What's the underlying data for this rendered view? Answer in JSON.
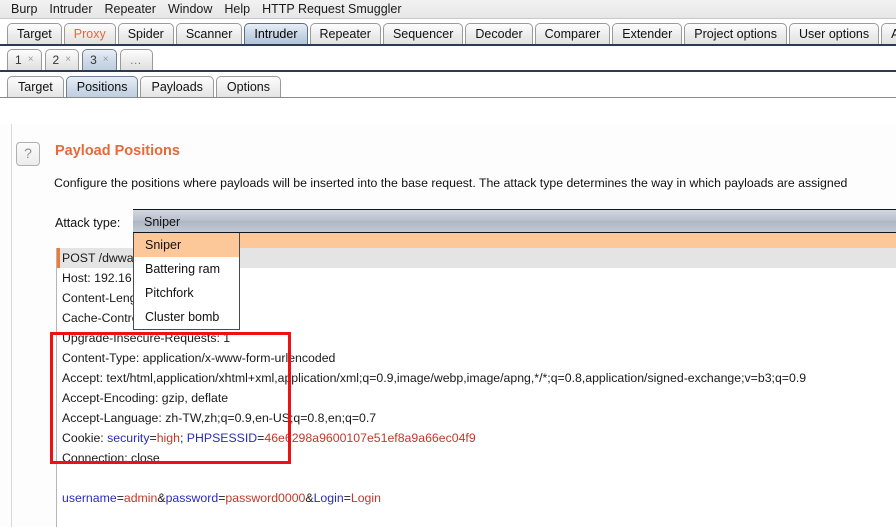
{
  "menubar": {
    "items": [
      {
        "label": "Burp"
      },
      {
        "label": "Intruder"
      },
      {
        "label": "Repeater"
      },
      {
        "label": "Window"
      },
      {
        "label": "Help"
      },
      {
        "label": "HTTP Request Smuggler"
      }
    ]
  },
  "main_tabs": [
    {
      "label": "Target",
      "state": "normal"
    },
    {
      "label": "Proxy",
      "state": "accent"
    },
    {
      "label": "Spider",
      "state": "normal"
    },
    {
      "label": "Scanner",
      "state": "normal"
    },
    {
      "label": "Intruder",
      "state": "active"
    },
    {
      "label": "Repeater",
      "state": "normal"
    },
    {
      "label": "Sequencer",
      "state": "normal"
    },
    {
      "label": "Decoder",
      "state": "normal"
    },
    {
      "label": "Comparer",
      "state": "normal"
    },
    {
      "label": "Extender",
      "state": "normal"
    },
    {
      "label": "Project options",
      "state": "normal"
    },
    {
      "label": "User options",
      "state": "normal"
    },
    {
      "label": "Alerts",
      "state": "normal"
    }
  ],
  "attack_tabs": [
    {
      "label": "1",
      "close": "×",
      "state": "normal"
    },
    {
      "label": "2",
      "close": "×",
      "state": "normal"
    },
    {
      "label": "3",
      "close": "×",
      "state": "active"
    },
    {
      "label": "…",
      "close": "",
      "state": "dots"
    }
  ],
  "sub_tabs": [
    {
      "label": "Target",
      "state": "normal"
    },
    {
      "label": "Positions",
      "state": "active"
    },
    {
      "label": "Payloads",
      "state": "normal"
    },
    {
      "label": "Options",
      "state": "normal"
    }
  ],
  "panel": {
    "help_icon": "?",
    "title": "Payload Positions",
    "description": "Configure the positions where payloads will be inserted into the base request. The attack type determines the way in which payloads are assigned"
  },
  "attack_type": {
    "label": "Attack type:",
    "selected": "Sniper",
    "options": [
      {
        "label": "Sniper",
        "selected": true
      },
      {
        "label": "Battering ram",
        "selected": false
      },
      {
        "label": "Pitchfork",
        "selected": false
      },
      {
        "label": "Cluster bomb",
        "selected": false
      }
    ]
  },
  "request": {
    "lines": [
      {
        "text": "POST /dwwa/",
        "style": "first"
      },
      {
        "text": "Host: 192.16",
        "style": "plain"
      },
      {
        "text": "Content-Leng",
        "style": "plain"
      },
      {
        "text": "Cache-Contro",
        "style": "plain"
      },
      {
        "text": "Upgrade-Insecure-Requests: 1",
        "style": "plain"
      },
      {
        "text": "Content-Type: application/x-www-form-urlencoded",
        "style": "plain"
      },
      {
        "text": "Accept: text/html,application/xhtml+xml,application/xml;q=0.9,image/webp,image/apng,*/*;q=0.8,application/signed-exchange;v=b3;q=0.9",
        "style": "plain"
      },
      {
        "text": "Accept-Encoding: gzip, deflate",
        "style": "plain"
      },
      {
        "text": "Accept-Language: zh-TW,zh;q=0.9,en-US;q=0.8,en;q=0.7",
        "style": "plain"
      },
      {
        "style": "cookie",
        "prefix": "Cookie: ",
        "parts": [
          {
            "text": "security",
            "kind": "key"
          },
          {
            "text": "=",
            "kind": "plain"
          },
          {
            "text": "high",
            "kind": "val"
          },
          {
            "text": "; ",
            "kind": "plain"
          },
          {
            "text": "PHPSESSID",
            "kind": "key"
          },
          {
            "text": "=",
            "kind": "plain"
          },
          {
            "text": "46e6298a9600107e51ef8a9a66ec04f9",
            "kind": "val"
          }
        ]
      },
      {
        "text": "Connection: close",
        "style": "plain"
      },
      {
        "text": "",
        "style": "blank"
      },
      {
        "style": "body",
        "prefix": "",
        "parts": [
          {
            "text": "username",
            "kind": "key"
          },
          {
            "text": "=",
            "kind": "plain"
          },
          {
            "text": "admin",
            "kind": "val"
          },
          {
            "text": "&",
            "kind": "plain"
          },
          {
            "text": "password",
            "kind": "key"
          },
          {
            "text": "=",
            "kind": "plain"
          },
          {
            "text": "password0000",
            "kind": "val"
          },
          {
            "text": "&",
            "kind": "plain"
          },
          {
            "text": "Login",
            "kind": "key"
          },
          {
            "text": "=",
            "kind": "plain"
          },
          {
            "text": "Login",
            "kind": "val"
          }
        ]
      }
    ]
  },
  "colors": {
    "accent_orange": "#e8683a",
    "highlight_peach": "#fcc89a",
    "annotation_red": "#ee1111",
    "param_key_blue": "#2b2bbf",
    "param_value_red": "#c0392b"
  }
}
